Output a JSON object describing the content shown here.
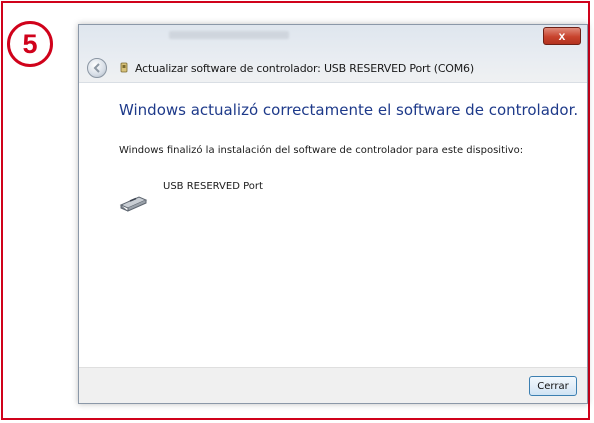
{
  "step": {
    "number": "5",
    "color": "#d0021b"
  },
  "window": {
    "close_glyph": "x",
    "title": "Actualizar software de controlador: USB RESERVED Port (COM6)",
    "back_icon": "back-arrow-icon",
    "title_icon": "device-icon"
  },
  "content": {
    "heading": "Windows actualizó correctamente el software de controlador.",
    "description": "Windows finalizó la instalación del software de controlador para este dispositivo:",
    "device_name": "USB RESERVED Port",
    "device_icon": "usb-port-icon",
    "heading_color": "#1e3a8a"
  },
  "footer": {
    "close_label": "Cerrar"
  }
}
